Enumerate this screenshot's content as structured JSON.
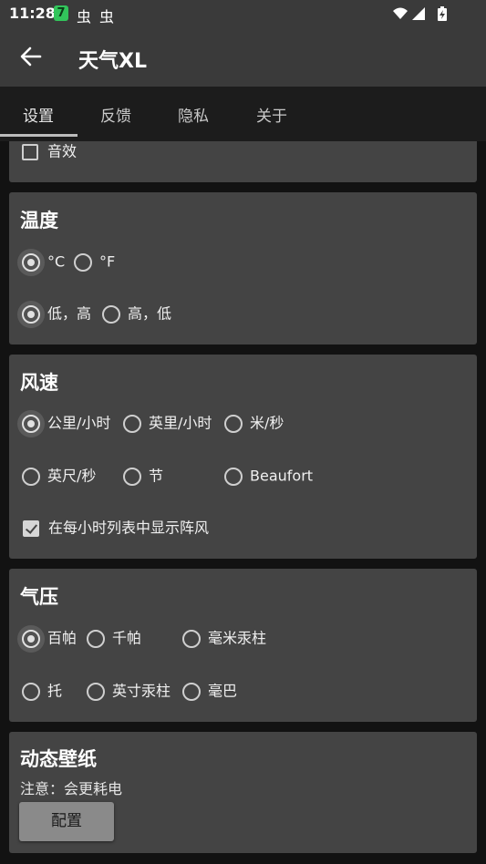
{
  "status_bar": {
    "time": "11:28",
    "badge": "7",
    "icon1": "虫",
    "icon2": "虫",
    "icons": [
      "wifi-icon",
      "signal-icon",
      "battery-icon"
    ]
  },
  "app_bar": {
    "title": "天气XL",
    "back_icon": "arrow-left-icon"
  },
  "tabs": [
    {
      "label": "设置",
      "active": true
    },
    {
      "label": "反馈",
      "active": false
    },
    {
      "label": "隐私",
      "active": false
    },
    {
      "label": "关于",
      "active": false
    }
  ],
  "sound": {
    "label": "音效",
    "checked": false
  },
  "temperature": {
    "title": "温度",
    "unit_options": [
      {
        "label": "°C",
        "selected": true
      },
      {
        "label": "°F",
        "selected": false
      }
    ],
    "order_options": [
      {
        "label": "低，高",
        "selected": true
      },
      {
        "label": "高，低",
        "selected": false
      }
    ]
  },
  "wind": {
    "title": "风速",
    "options": [
      {
        "label": "公里/小时",
        "selected": true
      },
      {
        "label": "英里/小时",
        "selected": false
      },
      {
        "label": "米/秒",
        "selected": false
      },
      {
        "label": "英尺/秒",
        "selected": false
      },
      {
        "label": "节",
        "selected": false
      },
      {
        "label": "Beaufort",
        "selected": false
      }
    ],
    "gust": {
      "label": "在每小时列表中显示阵风",
      "checked": true
    }
  },
  "pressure": {
    "title": "气压",
    "options": [
      {
        "label": "百帕",
        "selected": true
      },
      {
        "label": "千帕",
        "selected": false
      },
      {
        "label": "毫米汞柱",
        "selected": false
      },
      {
        "label": "托",
        "selected": false
      },
      {
        "label": "英寸汞柱",
        "selected": false
      },
      {
        "label": "毫巴",
        "selected": false
      }
    ]
  },
  "wallpaper": {
    "title": "动态壁纸",
    "note": "注意：会更耗电",
    "button": "配置"
  },
  "colors": {
    "background": "#121212",
    "app_bar": "#3a3a3a",
    "card": "#444444",
    "badge": "#32c55b"
  }
}
